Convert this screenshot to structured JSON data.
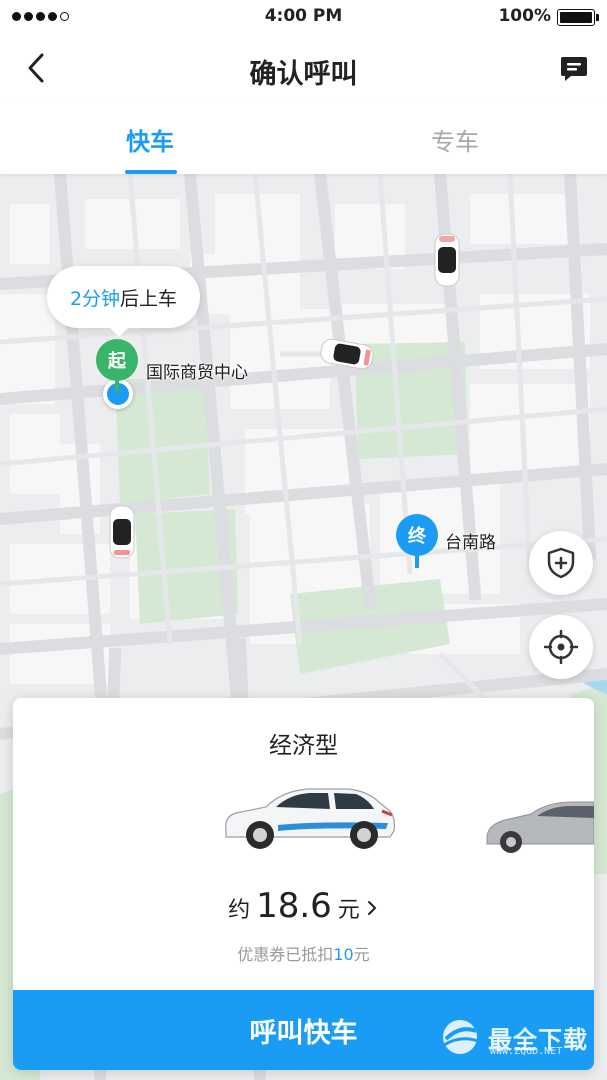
{
  "status_bar": {
    "time": "4:00 PM",
    "battery": "100%",
    "signal_icon": "signal-dots-icon",
    "battery_icon": "battery-icon"
  },
  "nav": {
    "title": "确认呼叫",
    "back_icon": "chevron-left-icon",
    "message_icon": "message-icon"
  },
  "tabs": [
    {
      "label": "快车",
      "active": true
    },
    {
      "label": "专车",
      "active": false
    }
  ],
  "map": {
    "bubble": {
      "minutes": "2分钟",
      "suffix": "后上车"
    },
    "start": {
      "badge": "起",
      "name": "国际商贸中心"
    },
    "end": {
      "badge": "终",
      "name": "台南路"
    },
    "safety_icon": "shield-plus-icon",
    "locate_icon": "crosshair-icon",
    "car_icon": "car-top-icon"
  },
  "card": {
    "car_type": "经济型",
    "price_prefix": "约",
    "price": "18.6",
    "price_unit": "元",
    "discount_prefix": "优惠券已抵扣",
    "discount_amount": "10",
    "discount_unit": "元",
    "call_label": "呼叫快车"
  },
  "watermark": {
    "text": "最全下载",
    "url": "WWW.ZQGD.NET"
  },
  "colors": {
    "accent": "#1a9cf5",
    "start_green": "#39b56a",
    "map_bg": "#ecedef",
    "park_green": "#d5e8d4"
  }
}
